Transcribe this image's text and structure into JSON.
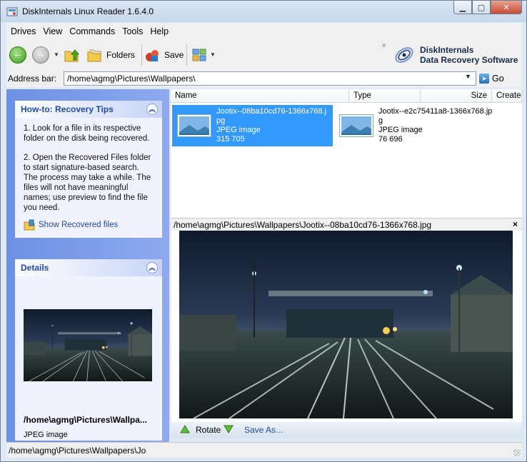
{
  "window": {
    "title": "DiskInternals Linux Reader 1.6.4.0"
  },
  "menu": [
    "Drives",
    "View",
    "Commands",
    "Tools",
    "Help"
  ],
  "toolbar": {
    "folders_label": "Folders",
    "save_label": "Save",
    "brand_line1": "DiskInternals",
    "brand_line2": "Data Recovery Software"
  },
  "address": {
    "label": "Address bar:",
    "value": "/home\\agmg\\Pictures\\Wallpapers\\",
    "go_label": "Go"
  },
  "tips": {
    "title": "How-to: Recovery Tips",
    "para1": "1. Look for a file in its respective folder on the disk being recovered.",
    "para2": "2. Open the Recovered Files folder to start signature-based search. The process may take a while. The files will not have meaningful names; use preview to find the file you need.",
    "link": "Show Recovered files"
  },
  "details": {
    "title": "Details",
    "path": "/home\\agmg\\Pictures\\Wallpa...",
    "type": "JPEG image"
  },
  "filelist": {
    "columns": [
      "Name",
      "Type",
      "Size",
      "Created"
    ],
    "files": [
      {
        "name": "Jootix--08ba10cd76-1366x768.jpg",
        "type": "JPEG image",
        "size": "315 705",
        "selected": true
      },
      {
        "name": "Jootix--e2c75411a8-1366x768.jpg",
        "type": "JPEG image",
        "size": "76 696",
        "selected": false
      }
    ]
  },
  "preview": {
    "path": "/home\\agmg\\Pictures\\Wallpapers\\Jootix--08ba10cd76-1366x768.jpg",
    "close": "×",
    "rotate_label": "Rotate",
    "saveas_label": "Save As..."
  },
  "status": {
    "text": "/home\\agmg\\Pictures\\Wallpapers\\Jo"
  },
  "icons": {
    "back": "back-arrow-icon",
    "forward": "forward-arrow-icon",
    "up": "folder-up-icon",
    "folders": "folders-icon",
    "save": "save-icon",
    "view": "view-mode-icon"
  }
}
